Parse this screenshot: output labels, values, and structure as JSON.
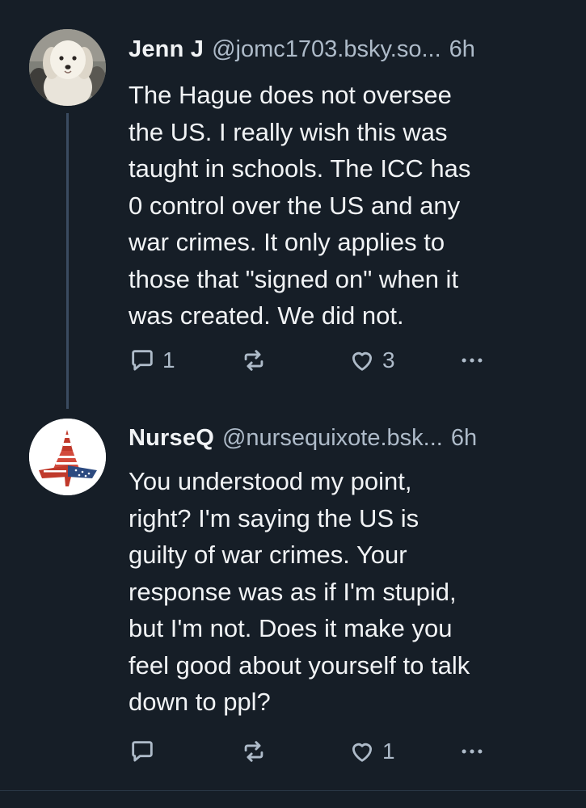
{
  "posts": [
    {
      "author": {
        "display_name": "Jenn J",
        "handle": "@jomc1703.bsky.so...",
        "avatar": "white-dog-photo"
      },
      "time": "6h",
      "text": "The Hague does not oversee\nthe US. I really wish this was\ntaught in schools. The ICC has\n0 control over the US and any\nwar crimes. It only applies to\nthose that \"signed on\" when it\nwas created. We did not.",
      "reply_count": "1",
      "repost_count": "",
      "like_count": "3"
    },
    {
      "author": {
        "display_name": "NurseQ",
        "handle": "@nursequixote.bsk...",
        "avatar": "flag-nurse-figure"
      },
      "time": "6h",
      "text": "You understood my point,\nright? I'm saying the US is\nguilty of war crimes. Your\nresponse was as if I'm stupid,\nbut I'm not. Does it make you\nfeel good about yourself to talk\ndown to ppl?",
      "reply_count": "",
      "repost_count": "",
      "like_count": "1"
    }
  ],
  "icons": {
    "reply": "reply-icon",
    "repost": "repost-icon",
    "like": "heart-icon",
    "more": "more-icon"
  },
  "colors": {
    "background": "#161e27",
    "text": "#f1f3f5",
    "secondary": "#aebbc9",
    "thread_line": "#3a4b60"
  }
}
